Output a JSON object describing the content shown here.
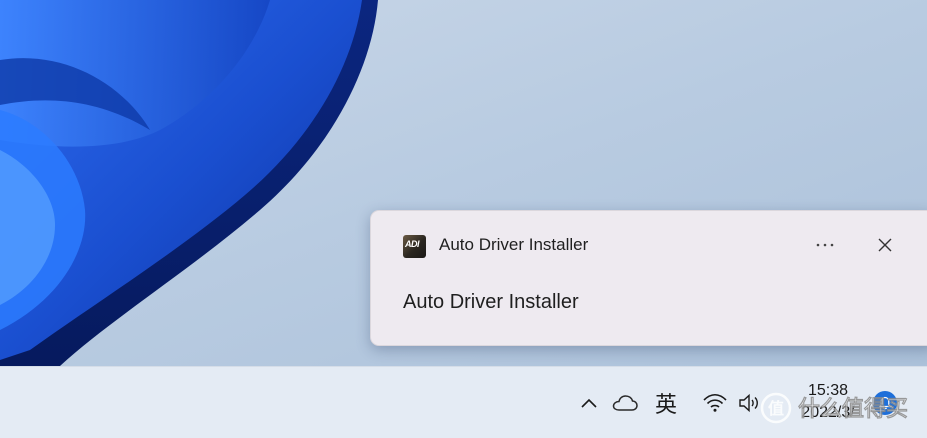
{
  "toast": {
    "app_name": "Auto Driver Installer",
    "app_icon_text": "ADI",
    "body_text": "Auto Driver Installer",
    "more_label": "···",
    "icons": {
      "app": "adi-app-icon",
      "more": "more-options-icon",
      "close": "close-icon"
    }
  },
  "taskbar": {
    "ime_label": "英",
    "clock": {
      "time": "15:38",
      "date": "2022/3/"
    },
    "icons": {
      "overflow": "chevron-up-icon",
      "onedrive": "cloud-icon",
      "wifi": "wifi-icon",
      "volume": "speaker-icon",
      "notifications": "notification-icon"
    }
  },
  "watermark": {
    "text": "什么值得买"
  },
  "colors": {
    "wallpaper_blue": "#1e5ad6",
    "wallpaper_dark": "#0a2a8a",
    "toast_bg": "#eeeaf0",
    "taskbar_bg": "#e4ebf4",
    "accent": "#1e6fd9"
  }
}
